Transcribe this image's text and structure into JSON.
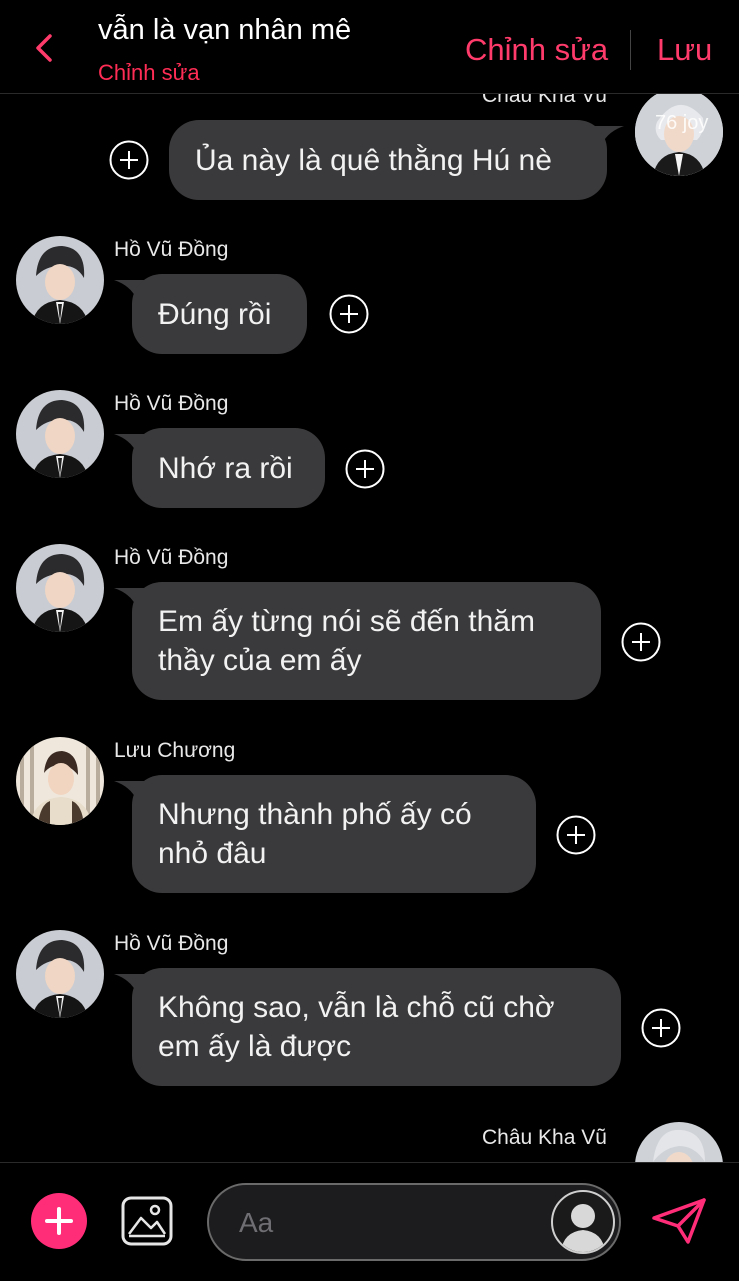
{
  "header": {
    "title": "vẫn là vạn nhân mê",
    "subtitle": "Chỉnh sửa",
    "edit_label": "Chỉnh sửa",
    "save_label": "Lưu",
    "accent_color": "#ff3b6b"
  },
  "messages": [
    {
      "sender": "Châu Kha Vũ",
      "text": "Ủa này là quê thằng Hú nè",
      "side": "right",
      "avatar_watermark": "76 joy"
    },
    {
      "sender": "Hồ Vũ Đồng",
      "text": "Đúng rồi",
      "side": "left"
    },
    {
      "sender": "Hồ Vũ Đồng",
      "text": "Nhớ ra rồi",
      "side": "left"
    },
    {
      "sender": "Hồ Vũ Đồng",
      "text": "Em ấy từng nói sẽ đến thăm\nthầy của em ấy",
      "side": "left"
    },
    {
      "sender": "Lưu Chương",
      "text": "Nhưng thành phố ấy có\nnhỏ đâu",
      "side": "left"
    },
    {
      "sender": "Hồ Vũ Đồng",
      "text": "Không sao, vẫn là chỗ cũ chờ\nem ấy là được",
      "side": "left"
    },
    {
      "sender": "Châu Kha Vũ",
      "text": "",
      "side": "right"
    }
  ],
  "composer": {
    "placeholder": "Aa",
    "icons": [
      "plus-icon",
      "image-icon",
      "person-icon",
      "send-icon"
    ]
  },
  "colors": {
    "background": "#000000",
    "bubble": "#3a3a3c",
    "accent": "#ff2d78"
  }
}
